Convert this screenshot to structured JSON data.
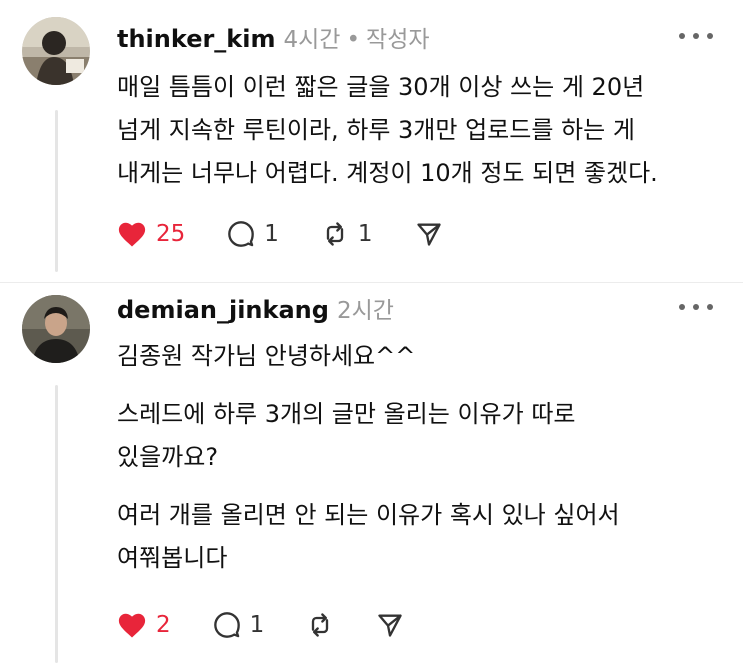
{
  "colors": {
    "like": "#e8253a",
    "meta": "#999999",
    "text": "#101010"
  },
  "posts": [
    {
      "username": "thinker_kim",
      "time": "4시간",
      "badge": "작성자",
      "avatar_icon": "avatar-photo",
      "paragraphs": [
        "매일 틈틈이 이런 짧은 글을 30개 이상 쓰는 게 20년\n넘게 지속한 루틴이라, 하루 3개만 업로드를 하는 게\n내게는 너무나 어렵다. 계정이 10개 정도 되면 좋겠다."
      ],
      "likes": "25",
      "replies": "1",
      "reposts": "1"
    },
    {
      "username": "demian_jinkang",
      "time": "2시간",
      "avatar_icon": "avatar-photo",
      "paragraphs": [
        "김종원 작가님 안녕하세요^^",
        "스레드에 하루 3개의 글만 올리는 이유가 따로\n있을까요?",
        "여러 개를 올리면 안 되는 이유가 혹시 있나 싶어서\n여쭤봅니다"
      ],
      "likes": "2",
      "replies": "1"
    }
  ]
}
